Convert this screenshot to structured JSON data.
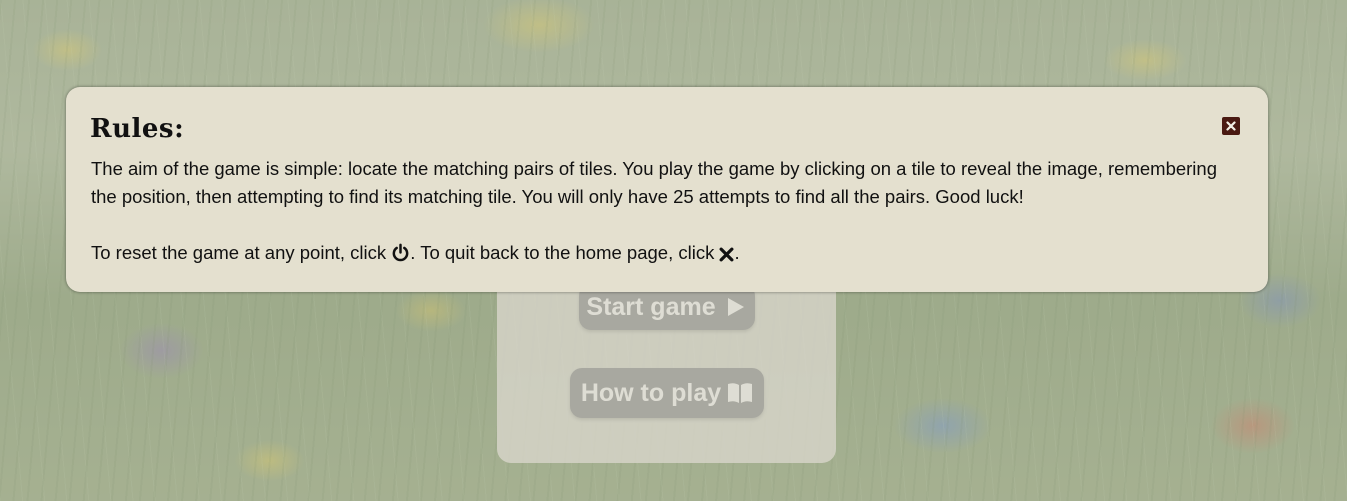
{
  "modal": {
    "title": "Rules:",
    "paragraph1": "The aim of the game is simple: locate the matching pairs of tiles. You play the game by clicking on a tile to reveal the image, remembering the position, then attempting to find its matching tile. You will only have 25 attempts to find all the pairs. Good luck!",
    "reset_prefix": "To reset the game at any point, click ",
    "reset_icon": "power-icon",
    "quit_text": ". To quit back to the home page, click ",
    "quit_icon": "x-icon",
    "end_text": ".",
    "close_icon": "close-square-icon"
  },
  "menu": {
    "start_label": "Start game",
    "start_icon": "play-icon",
    "howto_label": "How to play",
    "howto_icon": "book-open-icon"
  },
  "colors": {
    "modal_bg": "#e4e0cf",
    "close_bg": "#4a1a12",
    "button_bg": "#8f8f88",
    "button_text": "#e6e4dc"
  }
}
